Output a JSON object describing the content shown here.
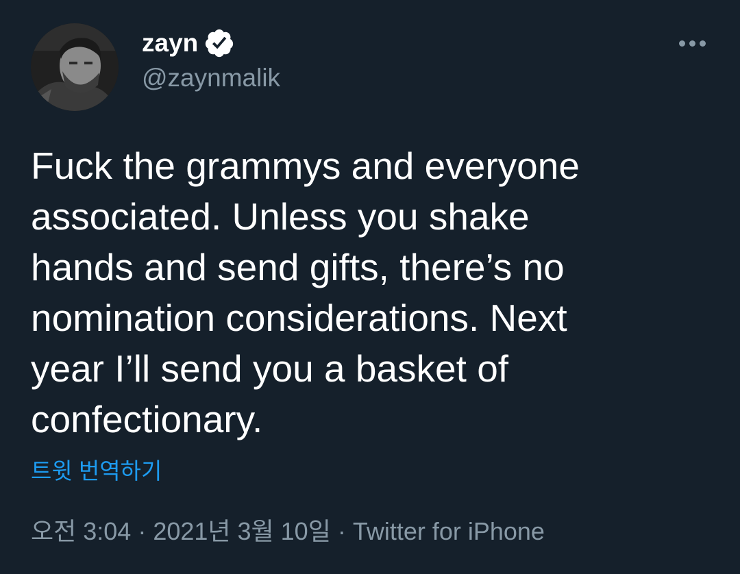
{
  "user": {
    "display_name": "zayn",
    "handle": "@zaynmalik",
    "verified": true,
    "avatar_icon": "user-avatar"
  },
  "actions": {
    "more_icon": "more-horizontal-icon"
  },
  "tweet": {
    "lines": [
      "Fuck the grammys and everyone",
      "associated. Unless you shake",
      "hands and send gifts, there’s no",
      "nomination considerations. Next",
      "year I’ll send you a basket of",
      "confectionary."
    ],
    "translate_label": "트윗 번역하기",
    "time": "오전 3:04",
    "date": "2021년 3월 10일",
    "separator": "·",
    "source": "Twitter for iPhone"
  },
  "colors": {
    "background": "#15202b",
    "text": "#ffffff",
    "secondary": "#8899a6",
    "link": "#1d9bf0",
    "verified": "#ffffff"
  }
}
